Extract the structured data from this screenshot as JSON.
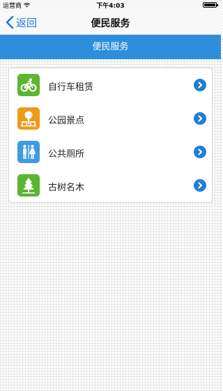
{
  "status_bar": {
    "carrier": "运营商",
    "time": "下午4:03"
  },
  "nav": {
    "back_label": "返回",
    "title": "便民服务"
  },
  "section": {
    "title": "便民服务"
  },
  "services": [
    {
      "label": "自行车租赁",
      "icon": "bicycle-icon",
      "color": "#5cb531"
    },
    {
      "label": "公园景点",
      "icon": "park-bench-icon",
      "color": "#f09a1a"
    },
    {
      "label": "公共厕所",
      "icon": "restroom-icon",
      "color": "#3e9be0"
    },
    {
      "label": "古树名木",
      "icon": "tree-icon",
      "color": "#5cb531"
    }
  ],
  "colors": {
    "accent": "#2d8fdc",
    "nav_link": "#1a7ed8",
    "arrow": "#1f7fd4"
  }
}
